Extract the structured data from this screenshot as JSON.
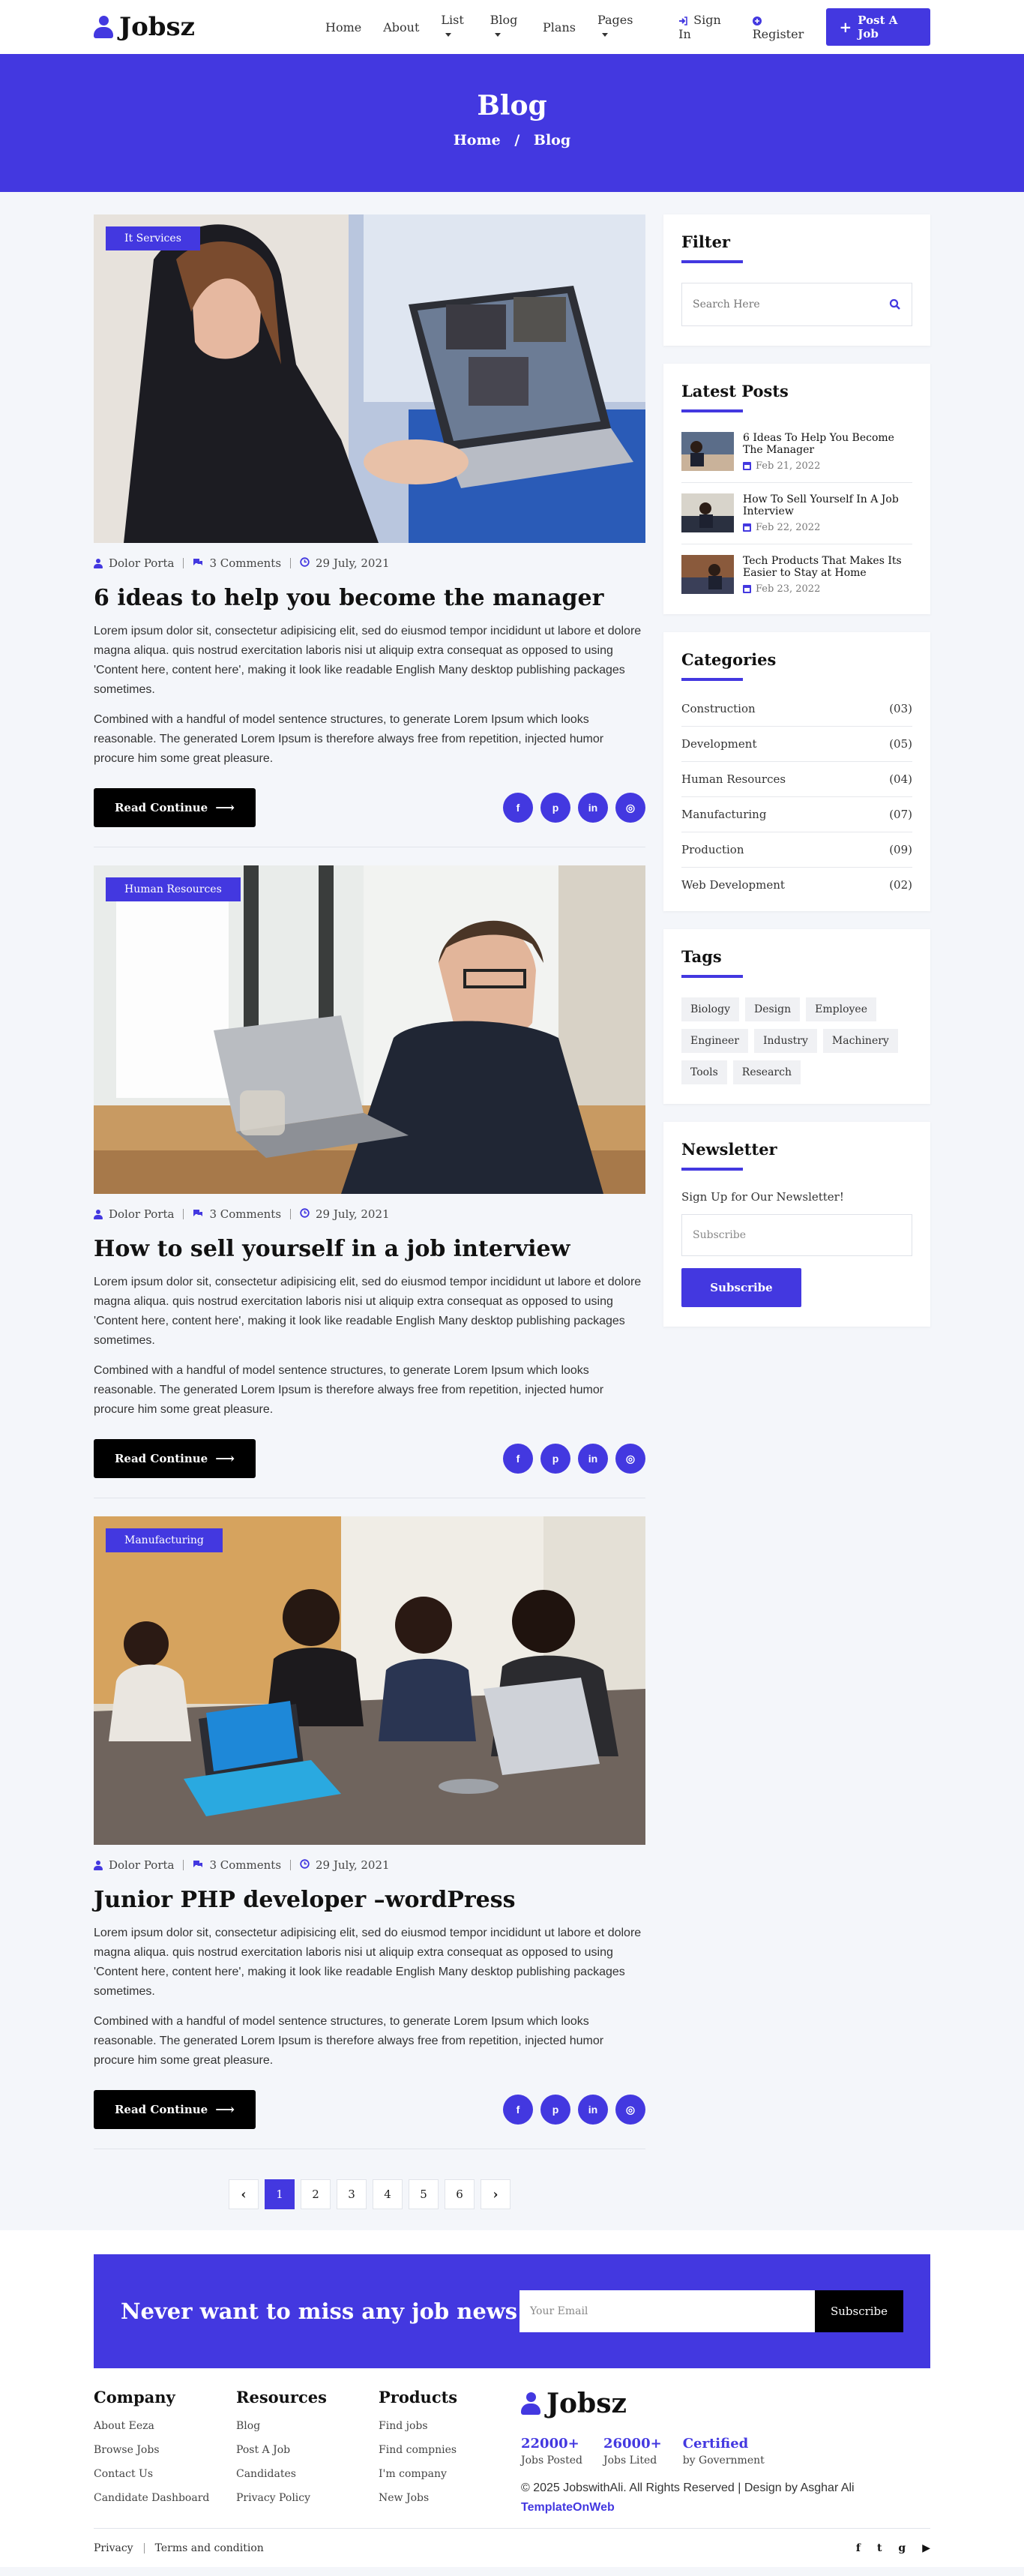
{
  "header": {
    "brand": "Jobsz",
    "nav": [
      {
        "label": "Home",
        "dropdown": false,
        "active": false
      },
      {
        "label": "About",
        "dropdown": false,
        "active": false
      },
      {
        "label": "List",
        "dropdown": true,
        "active": false
      },
      {
        "label": "Blog",
        "dropdown": true,
        "active": true
      },
      {
        "label": "Plans",
        "dropdown": false,
        "active": false
      },
      {
        "label": "Pages",
        "dropdown": true,
        "active": false
      }
    ],
    "sign_in": "Sign In",
    "register": "Register",
    "post_job": "Post A Job"
  },
  "hero": {
    "title": "Blog",
    "crumb_home": "Home",
    "crumb_sep": "/",
    "crumb_current": "Blog"
  },
  "posts": [
    {
      "tag": "It Services",
      "author": "Dolor Porta",
      "comments": "3 Comments",
      "date": "29 July, 2021",
      "title": "6 ideas to help you become the manager",
      "p1": "Lorem ipsum dolor sit, consectetur adipisicing elit, sed do eiusmod tempor incididunt ut labore et dolore magna aliqua. quis nostrud exercitation laboris nisi ut aliquip extra consequat as opposed to using 'Content here, content here', making it look like readable English Many desktop publishing packages sometimes.",
      "p2": "Combined with a handful of model sentence structures, to generate Lorem Ipsum which looks reasonable. The generated Lorem Ipsum is therefore always free from repetition, injected humor procure him some great pleasure.",
      "read_more": "Read Continue"
    },
    {
      "tag": "Human Resources",
      "author": "Dolor Porta",
      "comments": "3 Comments",
      "date": "29 July, 2021",
      "title": "How to sell yourself in a job interview",
      "p1": "Lorem ipsum dolor sit, consectetur adipisicing elit, sed do eiusmod tempor incididunt ut labore et dolore magna aliqua. quis nostrud exercitation laboris nisi ut aliquip extra consequat as opposed to using 'Content here, content here', making it look like readable English Many desktop publishing packages sometimes.",
      "p2": "Combined with a handful of model sentence structures, to generate Lorem Ipsum which looks reasonable. The generated Lorem Ipsum is therefore always free from repetition, injected humor procure him some great pleasure.",
      "read_more": "Read Continue"
    },
    {
      "tag": "Manufacturing",
      "author": "Dolor Porta",
      "comments": "3 Comments",
      "date": "29 July, 2021",
      "title": "Junior PHP developer –wordPress",
      "p1": "Lorem ipsum dolor sit, consectetur adipisicing elit, sed do eiusmod tempor incididunt ut labore et dolore magna aliqua. quis nostrud exercitation laboris nisi ut aliquip extra consequat as opposed to using 'Content here, content here', making it look like readable English Many desktop publishing packages sometimes.",
      "p2": "Combined with a handful of model sentence structures, to generate Lorem Ipsum which looks reasonable. The generated Lorem Ipsum is therefore always free from repetition, injected humor procure him some great pleasure.",
      "read_more": "Read Continue"
    }
  ],
  "share_icons": [
    "facebook-icon",
    "pinterest-icon",
    "linkedin-icon",
    "dribbble-icon"
  ],
  "share_glyphs": [
    "f",
    "p",
    "in",
    "◎"
  ],
  "pagination": {
    "prev": "‹",
    "pages": [
      "1",
      "2",
      "3",
      "4",
      "5",
      "6"
    ],
    "current": "1",
    "next": "›"
  },
  "sidebar": {
    "filter": {
      "title": "Filter",
      "placeholder": "Search Here"
    },
    "latest": {
      "title": "Latest Posts",
      "items": [
        {
          "title": "6 Ideas To Help You Become The Manager",
          "date": "Feb 21, 2022"
        },
        {
          "title": "How To Sell Yourself In A Job Interview",
          "date": "Feb 22, 2022"
        },
        {
          "title": "Tech Products That Makes Its Easier to Stay at Home",
          "date": "Feb 23, 2022"
        }
      ]
    },
    "categories": {
      "title": "Categories",
      "items": [
        {
          "name": "Construction",
          "count": "(03)"
        },
        {
          "name": "Development",
          "count": "(05)"
        },
        {
          "name": "Human Resources",
          "count": "(04)"
        },
        {
          "name": "Manufacturing",
          "count": "(07)"
        },
        {
          "name": "Production",
          "count": "(09)"
        },
        {
          "name": "Web Development",
          "count": "(02)"
        }
      ]
    },
    "tags": {
      "title": "Tags",
      "items": [
        "Biology",
        "Design",
        "Employee",
        "Engineer",
        "Industry",
        "Machinery",
        "Tools",
        "Research"
      ]
    },
    "newsletter": {
      "title": "Newsletter",
      "text": "Sign Up for Our Newsletter!",
      "placeholder": "Subscribe",
      "button": "Subscribe"
    }
  },
  "footer": {
    "news_title": "Never want to miss any job news",
    "email_placeholder": "Your Email",
    "subscribe": "Subscribe",
    "columns": [
      {
        "title": "Company",
        "links": [
          "About Eeza",
          "Browse Jobs",
          "Contact Us",
          "Candidate Dashboard"
        ]
      },
      {
        "title": "Resources",
        "links": [
          "Blog",
          "Post A Job",
          "Candidates",
          "Privacy Policy"
        ]
      },
      {
        "title": "Products",
        "links": [
          "Find jobs",
          "Find compnies",
          "I'm company",
          "New Jobs"
        ]
      }
    ],
    "brand": "Jobsz",
    "stats": [
      {
        "num": "22000+",
        "label": "Jobs Posted"
      },
      {
        "num": "26000+",
        "label": "Jobs Lited"
      },
      {
        "num": "Certified",
        "label": "by Government"
      }
    ],
    "copyright": "© 2025 JobswithAli. All Rights Reserved | Design by Asghar Ali",
    "copyright_link": "TemplateOnWeb",
    "privacy": "Privacy",
    "terms": "Terms and condition",
    "social_icons": [
      "facebook-icon",
      "twitter-icon",
      "github-icon",
      "youtube-icon"
    ],
    "social_glyphs": [
      "f",
      "t",
      "g",
      "▶"
    ]
  },
  "colors": {
    "accent": "#4338e0",
    "dark": "#000000",
    "page_bg": "#f4f6fa"
  }
}
